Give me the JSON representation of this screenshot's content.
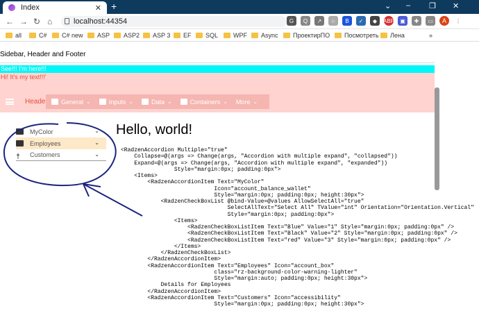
{
  "browser": {
    "tab_title": "Index",
    "url": "localhost:44354",
    "bookmarks": [
      "all",
      "C#",
      "C# new",
      "ASP",
      "ASP2",
      "ASP 3",
      "EF",
      "SQL",
      "WPF",
      "Async",
      "ПроектирПО",
      "Посмотреть",
      "Лена"
    ],
    "avatar_letter": "A"
  },
  "page": {
    "header_title": "Sidebar, Header and Footer",
    "cyan_text": "See!!! I'm here!!!",
    "pink_text": "Hi! It's my text!!!'",
    "header_label": "Header",
    "menu": [
      "General",
      "Inputs",
      "Data",
      "Containers",
      "More"
    ],
    "accordion": [
      "MyColor",
      "Employees",
      "Customers"
    ],
    "hello": "Hello, world!",
    "code_lines": [
      "<RadzenAccordion Multiple=\"true\"",
      "    Collapse=@(args => Change(args, \"Accordion with multiple expand\", \"collapsed\"))",
      "    Expand=@(args => Change(args, \"Accordion with multiple expand\", \"expanded\"))",
      "                Style=\"margin:0px; padding:0px\">",
      "    <Items>",
      "        <RadzenAccordionItem Text=\"MyColor\"",
      "                            Icon=\"account_balance_wallet\"",
      "                            Style=\"margin:0px; padding:0px; height:30px\">",
      "            <RadzenCheckBoxList @bind-Value=@values AllowSelectAll=\"true\"",
      "                                SelectAllText=\"Select All\" TValue=\"int\" Orientation=\"Orientation.Vertical\"",
      "                                Style=\"margin:0px; padding:0px\">",
      "                <Items>",
      "                    <RadzenCheckBoxListItem Text=\"Blue\" Value=\"1\" Style=\"margin:0px; padding:0px\" />",
      "                    <RadzenCheckBoxListItem Text=\"Black\" Value=\"2\" Style=\"margin:0px; padding:0px\" />",
      "                    <RadzenCheckBoxListItem Text=\"red\" Value=\"3\" Style=\"margin:0px; padding:0px\" />",
      "                </Items>",
      "            </RadzenCheckBoxList>",
      "        </RadzenAccordionItem>",
      "        <RadzenAccordionItem Text=\"Employees\" Icon=\"account_box\"",
      "                            class=\"rz-background-color-warning-lighter\"",
      "                            Style=\"margin:auto; padding:0px; height:30px\">",
      "            Details for Employees",
      "        </RadzenAccordionItem>",
      "        <RadzenAccordionItem Text=\"Customers\" Icon=\"accessibility\"",
      "                            Style=\"margin:0px; padding:0px; height:30px\">"
    ]
  },
  "colors": {
    "cyan": "#00f7f7",
    "pink": "#ffd3cf",
    "menu": "#f5b5b0",
    "accent": "#e74c3c",
    "annotation": "#1a237e"
  }
}
